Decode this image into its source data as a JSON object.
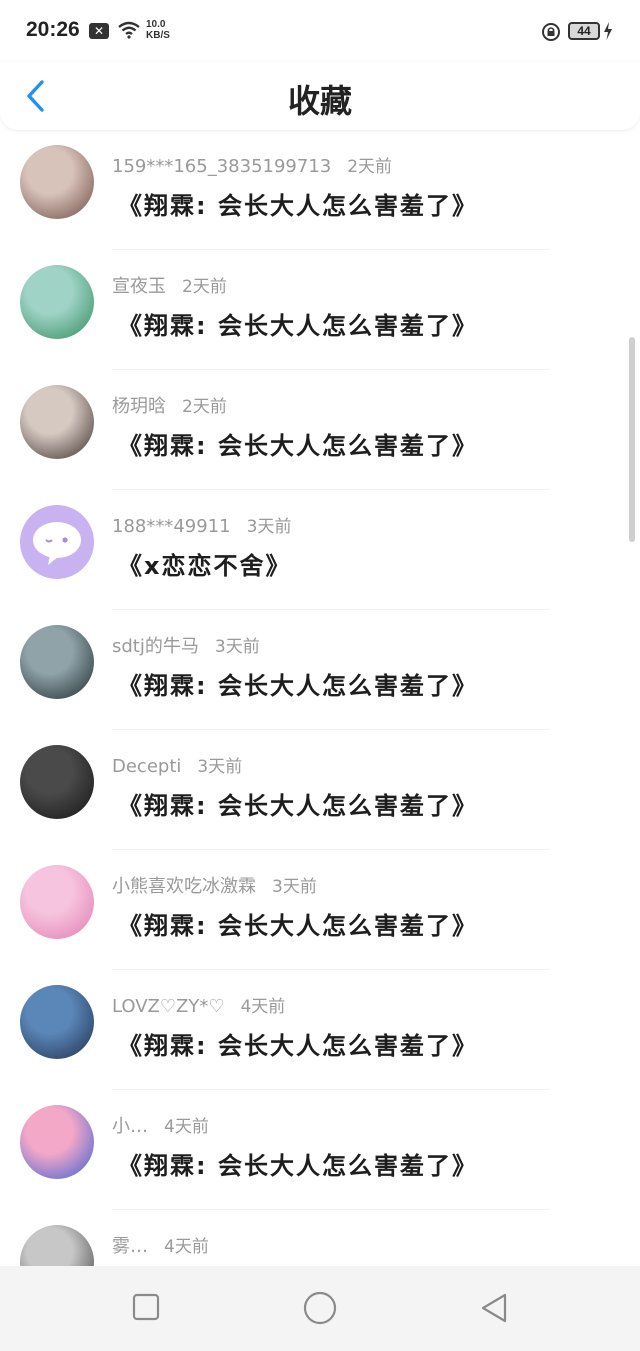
{
  "status": {
    "time": "20:26",
    "notif_icon": "x-icon",
    "net_speed_value": "10.0",
    "net_speed_unit": "KB/S",
    "battery": "44"
  },
  "header": {
    "title": "收藏"
  },
  "items": [
    {
      "user": "159***165_3835199713",
      "time": "2天前",
      "title": "《翔霖: 会长大人怎么害羞了》",
      "avatar_colors": [
        "#d8c3bb",
        "#6b4a40"
      ]
    },
    {
      "user": "宣夜玉",
      "time": "2天前",
      "title": "《翔霖: 会长大人怎么害羞了》",
      "avatar_colors": [
        "#9fd3c6",
        "#2f8a5c"
      ]
    },
    {
      "user": "杨玥晗",
      "time": "2天前",
      "title": "《翔霖: 会长大人怎么害羞了》",
      "avatar_colors": [
        "#d6c9c2",
        "#3a2d2a"
      ]
    },
    {
      "user": "188***49911",
      "time": "3天前",
      "title": "《x恋恋不舍》",
      "avatar_colors": [
        "#c9b2f0",
        "#a88be3"
      ]
    },
    {
      "user": "sdtj的牛马",
      "time": "3天前",
      "title": "《翔霖: 会长大人怎么害羞了》",
      "avatar_colors": [
        "#8fa3a8",
        "#1d2a2e"
      ]
    },
    {
      "user": "Decepti",
      "time": "3天前",
      "title": "《翔霖: 会长大人怎么害羞了》",
      "avatar_colors": [
        "#4a4a4a",
        "#141414"
      ]
    },
    {
      "user": "小熊喜欢吃冰激霖",
      "time": "3天前",
      "title": "《翔霖: 会长大人怎么害羞了》",
      "avatar_colors": [
        "#f6c4de",
        "#e07bb1"
      ]
    },
    {
      "user": "LOVZ♡ZY*♡",
      "time": "4天前",
      "title": "《翔霖: 会长大人怎么害羞了》",
      "avatar_colors": [
        "#5b86b8",
        "#1f2f4a"
      ]
    },
    {
      "user": "小…",
      "time": "4天前",
      "title": "《翔霖: 会长大人怎么害羞了》",
      "avatar_colors": [
        "#f4a8c8",
        "#3b5fd1"
      ]
    },
    {
      "user": "雾…",
      "time": "4天前",
      "title": "",
      "avatar_colors": [
        "#c7c7c7",
        "#3d3d3d"
      ]
    }
  ],
  "nav": {
    "recent_icon": "square-icon",
    "home_icon": "circle-icon",
    "back_icon": "triangle-back-icon"
  },
  "colors": {
    "accent": "#1e90ff",
    "nav_bg": "#f4f4f4"
  }
}
